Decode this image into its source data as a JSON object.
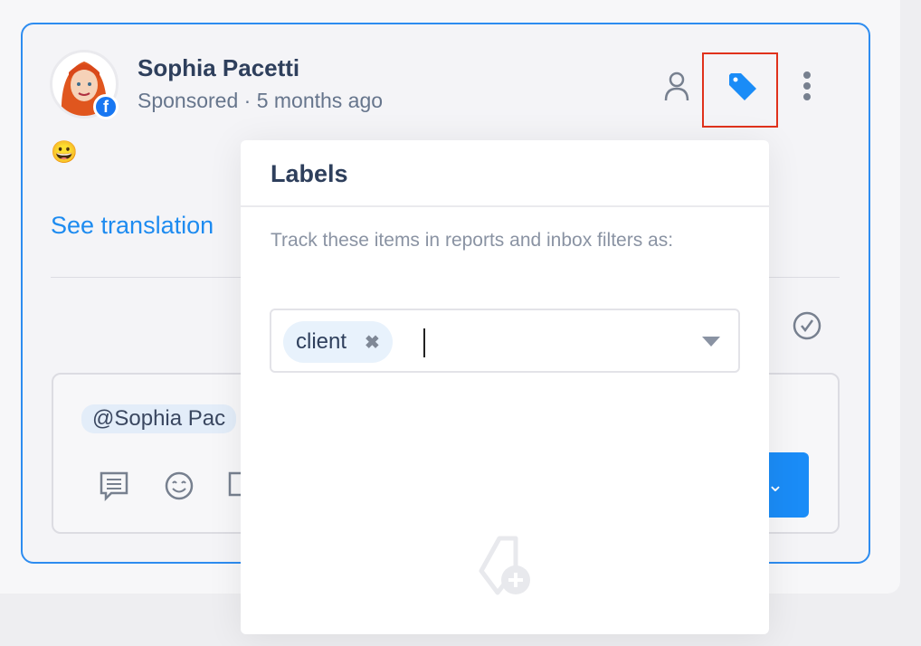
{
  "post": {
    "author": "Sophia Pacetti",
    "meta": "Sponsored · 5 months ago",
    "emoji": "😀",
    "see_translation": "See translation",
    "network_icon": "facebook-icon"
  },
  "reply": {
    "mention": "@Sophia Pac"
  },
  "labels_popup": {
    "title": "Labels",
    "description": "Track these items in reports and inbox filters as:",
    "selected_labels": [
      "client"
    ],
    "input_value": ""
  },
  "colors": {
    "accent": "#1a8cf7",
    "card_border": "#2d8cf0",
    "highlight": "#e0321c"
  }
}
